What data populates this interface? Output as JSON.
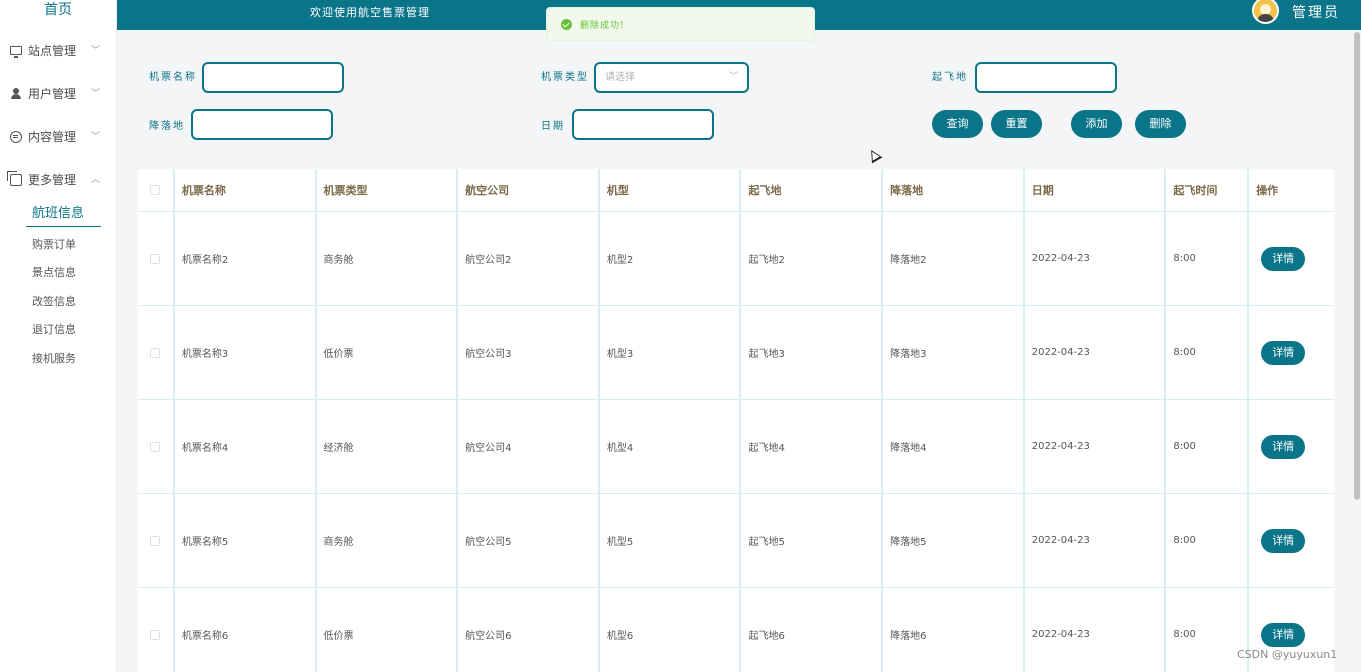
{
  "sidebar": {
    "home": "首页",
    "menus": [
      {
        "label": "站点管理",
        "icon": "monitor-icon"
      },
      {
        "label": "用户管理",
        "icon": "user-icon"
      },
      {
        "label": "内容管理",
        "icon": "chat-icon"
      },
      {
        "label": "更多管理",
        "icon": "copy-icon"
      }
    ],
    "active_sub": "航班信息",
    "subs": [
      "购票订单",
      "景点信息",
      "改签信息",
      "退订信息",
      "接机服务"
    ]
  },
  "header": {
    "welcome": "欢迎使用航空售票管理",
    "user": "管理员"
  },
  "toast": {
    "message": "删除成功!"
  },
  "search": {
    "labels": {
      "name": "机票名称",
      "type": "机票类型",
      "from": "起飞地",
      "to": "降落地",
      "date": "日期"
    },
    "type_placeholder": "请选择",
    "buttons": {
      "query": "查询",
      "reset": "重置",
      "add": "添加",
      "delete": "删除"
    }
  },
  "table": {
    "columns": [
      "机票名称",
      "机票类型",
      "航空公司",
      "机型",
      "起飞地",
      "降落地",
      "日期",
      "起飞时间",
      "操作"
    ],
    "detail_label": "详情",
    "rows": [
      [
        "机票名称2",
        "商务舱",
        "航空公司2",
        "机型2",
        "起飞地2",
        "降落地2",
        "2022-04-23",
        "8:00"
      ],
      [
        "机票名称3",
        "低价票",
        "航空公司3",
        "机型3",
        "起飞地3",
        "降落地3",
        "2022-04-23",
        "8:00"
      ],
      [
        "机票名称4",
        "经济舱",
        "航空公司4",
        "机型4",
        "起飞地4",
        "降落地4",
        "2022-04-23",
        "8:00"
      ],
      [
        "机票名称5",
        "商务舱",
        "航空公司5",
        "机型5",
        "起飞地5",
        "降落地5",
        "2022-04-23",
        "8:00"
      ],
      [
        "机票名称6",
        "低价票",
        "航空公司6",
        "机型6",
        "起飞地6",
        "降落地6",
        "2022-04-23",
        "8:00"
      ]
    ]
  },
  "watermark": "CSDN @yuyuxun1",
  "colors": {
    "primary": "#0a7489",
    "success": "#67c23a"
  }
}
